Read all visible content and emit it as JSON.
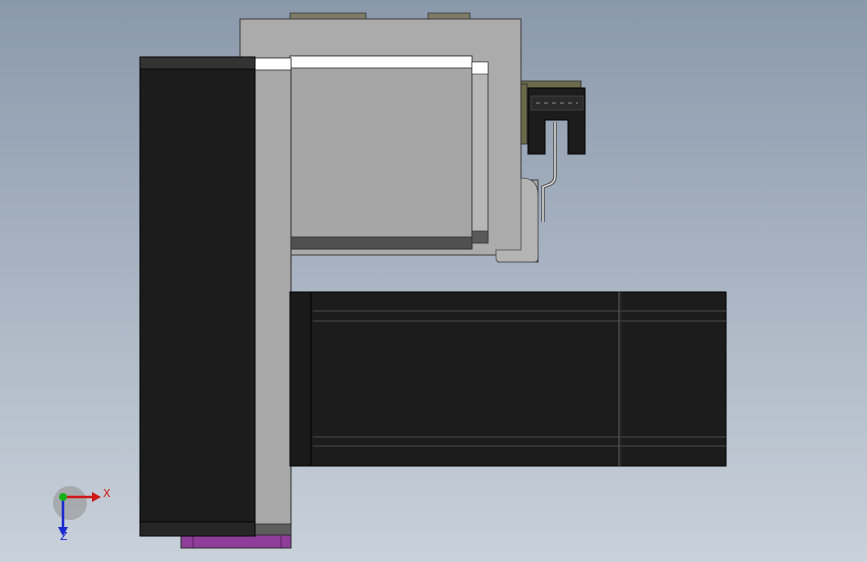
{
  "viewport": {
    "background_top": "#8a99ab",
    "background_bottom": "#c9d1da"
  },
  "triad": {
    "x_label": "X",
    "z_label": "Z",
    "x_color": "#d01818",
    "y_color": "#18b018",
    "z_color": "#1a2ad0"
  },
  "parts": {
    "frame_color": "#ababab",
    "plate_color": "#a8a8a8",
    "motor_color": "#1c1c1c",
    "base_plate_color": "#8e3e9a",
    "sensor_color": "#6b6a4a"
  }
}
